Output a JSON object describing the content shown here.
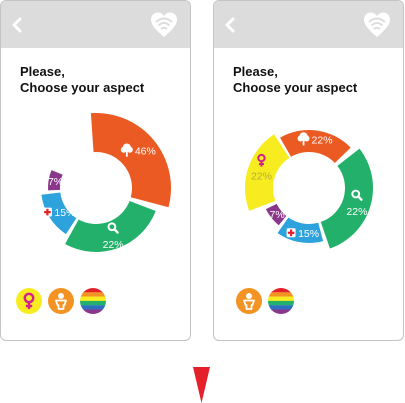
{
  "colors": {
    "orange": "#ea5a22",
    "green": "#23b06a",
    "blue": "#2da2dc",
    "purple": "#8a378b",
    "yellow": "#f7ec1f",
    "magenta": "#d61f8e",
    "chip_orange": "#f29323",
    "arrow_red": "#e4202a",
    "topbar": "#dcdcdc"
  },
  "screens": [
    {
      "heading_line1": "Please,",
      "heading_line2": "Choose your aspect",
      "segments": [
        {
          "key": "nature",
          "value": 46,
          "label": "46%",
          "color": "#ea5a22",
          "icon": "tree-icon"
        },
        {
          "key": "search",
          "value": 22,
          "label": "22%",
          "color": "#23b06a",
          "icon": "magnifier-icon"
        },
        {
          "key": "health",
          "value": 15,
          "label": "15%",
          "color": "#2da2dc",
          "icon": "medical-cross-icon"
        },
        {
          "key": "rights",
          "value": 7,
          "label": "7%",
          "color": "#8a378b",
          "icon": ""
        }
      ],
      "chips": [
        "female-symbol-icon",
        "child-icon",
        "rainbow-icon"
      ]
    },
    {
      "heading_line1": "Please,",
      "heading_line2": "Choose your aspect",
      "segments": [
        {
          "key": "nature",
          "value": 22,
          "label": "22%",
          "color": "#ea5a22",
          "icon": "tree-icon"
        },
        {
          "key": "search",
          "value": 22,
          "label": "22%",
          "color": "#23b06a",
          "icon": "magnifier-icon"
        },
        {
          "key": "health",
          "value": 15,
          "label": "15%",
          "color": "#2da2dc",
          "icon": "medical-cross-icon"
        },
        {
          "key": "rights",
          "value": 7,
          "label": "7%",
          "color": "#8a378b",
          "icon": ""
        },
        {
          "key": "women",
          "value": 22,
          "label": "22%",
          "color": "#f7ec1f",
          "icon": "female-symbol-icon"
        }
      ],
      "chips": [
        "child-icon",
        "rainbow-icon"
      ]
    }
  ]
}
